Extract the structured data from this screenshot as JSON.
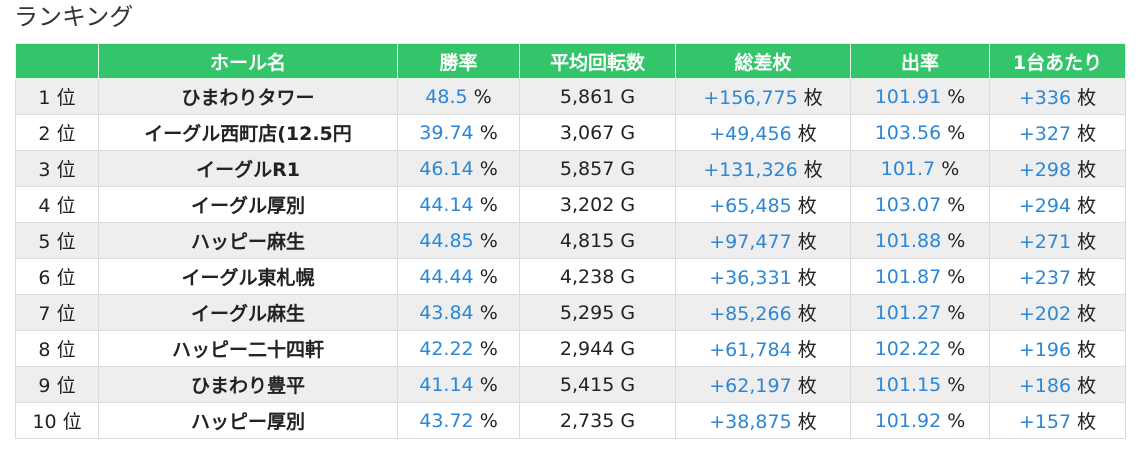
{
  "page": {
    "heading": "ランキング"
  },
  "table": {
    "headers": [
      "",
      "ホール名",
      "勝率",
      "平均回転数",
      "総差枚",
      "出率",
      "1台あたり"
    ],
    "units": {
      "rank": "位",
      "percent": "%",
      "games": "G",
      "coins": "枚"
    },
    "rows": [
      {
        "rank": "1",
        "hall": "ひまわりタワー",
        "win_rate": "48.5",
        "avg_spins": "5,861",
        "total_diff": "+156,775",
        "payout": "101.91",
        "per_machine": "+336"
      },
      {
        "rank": "2",
        "hall": "イーグル西町店(12.5円",
        "win_rate": "39.74",
        "avg_spins": "3,067",
        "total_diff": "+49,456",
        "payout": "103.56",
        "per_machine": "+327"
      },
      {
        "rank": "3",
        "hall": "イーグルR1",
        "win_rate": "46.14",
        "avg_spins": "5,857",
        "total_diff": "+131,326",
        "payout": "101.7",
        "per_machine": "+298"
      },
      {
        "rank": "4",
        "hall": "イーグル厚別",
        "win_rate": "44.14",
        "avg_spins": "3,202",
        "total_diff": "+65,485",
        "payout": "103.07",
        "per_machine": "+294"
      },
      {
        "rank": "5",
        "hall": "ハッピー麻生",
        "win_rate": "44.85",
        "avg_spins": "4,815",
        "total_diff": "+97,477",
        "payout": "101.88",
        "per_machine": "+271"
      },
      {
        "rank": "6",
        "hall": "イーグル東札幌",
        "win_rate": "44.44",
        "avg_spins": "4,238",
        "total_diff": "+36,331",
        "payout": "101.87",
        "per_machine": "+237"
      },
      {
        "rank": "7",
        "hall": "イーグル麻生",
        "win_rate": "43.84",
        "avg_spins": "5,295",
        "total_diff": "+85,266",
        "payout": "101.27",
        "per_machine": "+202"
      },
      {
        "rank": "8",
        "hall": "ハッピー二十四軒",
        "win_rate": "42.22",
        "avg_spins": "2,944",
        "total_diff": "+61,784",
        "payout": "102.22",
        "per_machine": "+196"
      },
      {
        "rank": "9",
        "hall": "ひまわり豊平",
        "win_rate": "41.14",
        "avg_spins": "5,415",
        "total_diff": "+62,197",
        "payout": "101.15",
        "per_machine": "+186"
      },
      {
        "rank": "10",
        "hall": "ハッピー厚別",
        "win_rate": "43.72",
        "avg_spins": "2,735",
        "total_diff": "+38,875",
        "payout": "101.92",
        "per_machine": "+157"
      }
    ]
  }
}
